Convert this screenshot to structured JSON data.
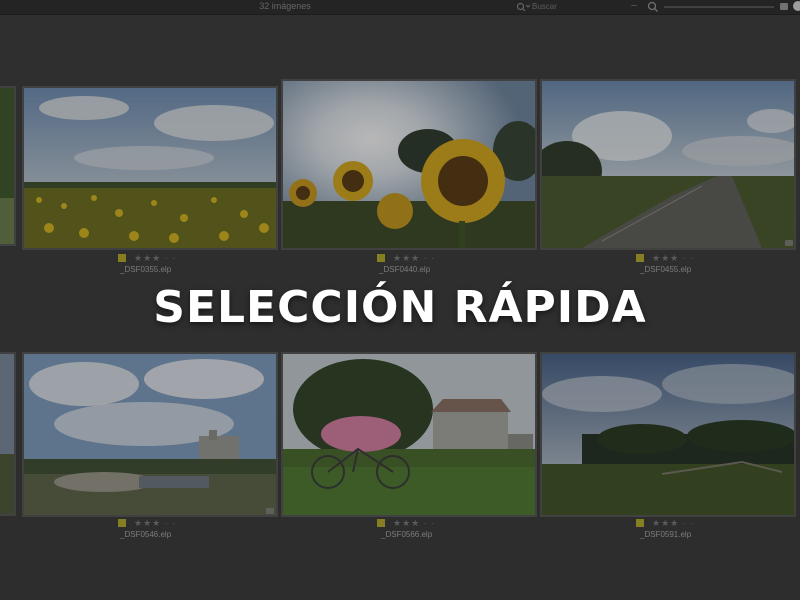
{
  "toolbar": {
    "image_count": "32 imágenes",
    "search_placeholder": "Buscar",
    "zoom_out_label": "–"
  },
  "headline": "SELECCIÓN RÁPIDA",
  "thumbnails": [
    {
      "filename": "_DSF0355.elp",
      "stars": "★★★ · ·",
      "flag_color": "#b7ac2a"
    },
    {
      "filename": "_DSF0440.elp",
      "stars": "★★★ · ·",
      "flag_color": "#b7ac2a"
    },
    {
      "filename": "_DSF0455.elp",
      "stars": "★★★ · ·",
      "flag_color": "#b7ac2a"
    },
    {
      "filename": "_DSF0546.elp",
      "stars": "★★★ · ·",
      "flag_color": "#b7ac2a"
    },
    {
      "filename": "_DSF0566.elp",
      "stars": "★★★ · ·",
      "flag_color": "#b7ac2a"
    },
    {
      "filename": "_DSF0591.elp",
      "stars": "★★★ · ·",
      "flag_color": "#b7ac2a"
    }
  ]
}
